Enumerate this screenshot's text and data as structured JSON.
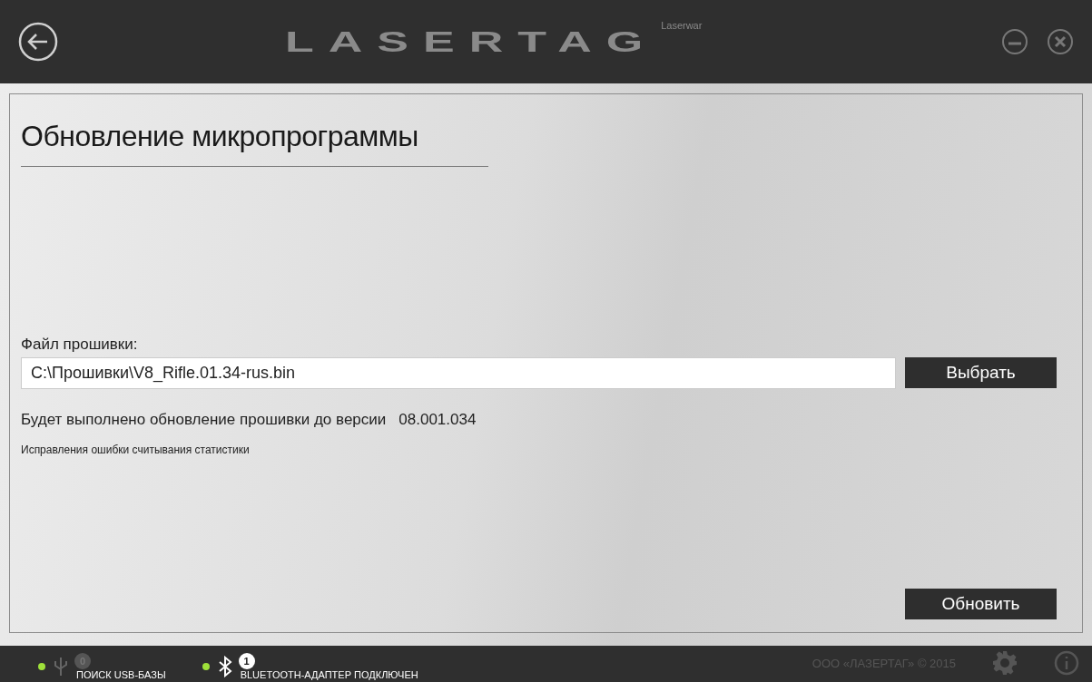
{
  "header": {
    "logo": "LASERTAG",
    "logo_caption": "Laserwar"
  },
  "page": {
    "title": "Обновление микропрограммы",
    "file_label": "Файл прошивки:",
    "file_path": "C:\\Прошивки\\V8_Rifle.01.34-rus.bin",
    "choose_button": "Выбрать",
    "version_text": "Будет выполнено обновление прошивки до версии",
    "version": "08.001.034",
    "description": "Исправления ошибки считывания статистики",
    "update_button": "Обновить"
  },
  "status_bar": {
    "items": [
      {
        "kind": "usb",
        "color": "#9ee03a",
        "count": "0",
        "count_active": false,
        "label": "ПОИСК USB-БАЗЫ"
      },
      {
        "kind": "bluetooth",
        "color": "#9ee03a",
        "count": "1",
        "count_active": true,
        "label": "BLUETOOTH-АДАПТЕР ПОДКЛЮЧЕН"
      }
    ],
    "copyright": "ООО «ЛАЗЕРТАГ» © 2015"
  }
}
